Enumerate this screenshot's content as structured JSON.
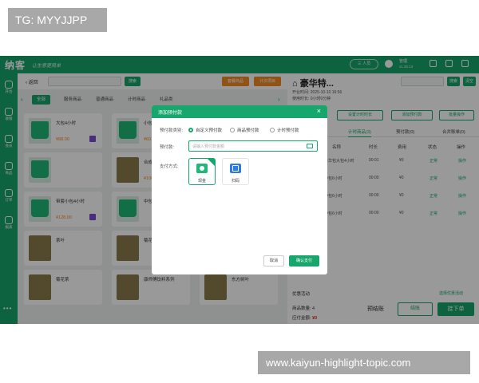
{
  "watermarks": {
    "top": "TG: MYYJJPP",
    "bottom": "www.kaiyun-highlight-topic.com"
  },
  "topbar": {
    "logo": "纳客",
    "slogan": "让生意更简单",
    "staff_button": "三 人员",
    "user_name": "管理",
    "version": "v1.30.13"
  },
  "sidebar": {
    "items": [
      "开台",
      "收银",
      "会员",
      "商品",
      "订单",
      "报表"
    ],
    "more": "更多"
  },
  "left": {
    "back": "返回",
    "search_placeholder": "输入商品名称/编码",
    "search_button": "搜索",
    "orange_buttons": [
      "套餐商品",
      "计次项目"
    ],
    "tabs": [
      "全部",
      "服务商品",
      "普通商品",
      "计时商品",
      "礼品类"
    ],
    "cards": [
      {
        "name": "大包4小时",
        "price": "¥88.00",
        "type": "bag"
      },
      {
        "name": "小包",
        "price": "¥60.00",
        "type": "bag"
      },
      {
        "name": "",
        "price": "¥48.00",
        "type": "bag"
      },
      {
        "name": "",
        "price": "",
        "type": "bag"
      },
      {
        "name": "合成装下100",
        "price": "¥100.00",
        "type": "photo"
      },
      {
        "name": "豪华",
        "price": "",
        "type": "bag"
      },
      {
        "name": "带套小包4小时",
        "price": "¥128.00",
        "type": "bag"
      },
      {
        "name": "中包",
        "price": "",
        "type": "bag"
      },
      {
        "name": "优雅大包6小时",
        "price": "¥168.00",
        "type": "bag"
      },
      {
        "name": "茶叶",
        "price": "",
        "type": "photo"
      },
      {
        "name": "菊花茶一杯",
        "price": "",
        "type": "photo"
      },
      {
        "name": "绿茶",
        "price": "",
        "type": "photo"
      },
      {
        "name": "菊花茶",
        "price": "",
        "type": "photo"
      },
      {
        "name": "康师傅饮料系列",
        "price": "",
        "type": "photo"
      },
      {
        "name": "东方树叶",
        "price": "",
        "type": "photo"
      }
    ]
  },
  "right": {
    "title": "豪华特...",
    "open_time": "开台时间: 2025-10-10 16:56",
    "used_time": "使用时长: 0小时0分钟",
    "search_buttons": [
      "搜索",
      "清空"
    ],
    "action_buttons": [
      "设置计时时长",
      "添加预付款",
      "批量操作"
    ],
    "tabs": [
      "计时商品(3)",
      "预付款(0)",
      "合并账单(0)"
    ],
    "headers": [
      "名称",
      "时长",
      "费用",
      "状态",
      "操作"
    ],
    "rows": [
      {
        "name": "豪华包大包4小时",
        "dur": "00:01",
        "fee": "¥0",
        "status": "正常",
        "op": "操作"
      },
      {
        "name": "中包6小时",
        "dur": "00:00",
        "fee": "¥0",
        "status": "正常",
        "op": "操作"
      },
      {
        "name": "中包6小时",
        "dur": "00:00",
        "fee": "¥0",
        "status": "正常",
        "op": "操作"
      },
      {
        "name": "中包6小时",
        "dur": "00:00",
        "fee": "¥0",
        "status": "正常",
        "op": "操作"
      }
    ],
    "discount_label": "优惠活动",
    "discount_link": "选择优惠活动",
    "count_label": "商品数量: 4",
    "amount_label": "应付金额:",
    "amount_value": "¥0",
    "prepay_button": "预结账",
    "settle_button": "结账",
    "order_button": "挂下单"
  },
  "modal": {
    "title": "添加预付款",
    "type_label": "预付款类别:",
    "options": [
      "自定义预付款",
      "商品预付款",
      "计时预付款"
    ],
    "amount_label": "预付款:",
    "amount_placeholder": "请输入预付款金额",
    "method_label": "支付方式:",
    "methods": [
      "现金",
      "扫码"
    ],
    "cancel": "取消",
    "confirm": "确认支付"
  },
  "colors": {
    "brand": "#17a66c",
    "accent_orange": "#f08a24",
    "amount_red": "#e2332f"
  }
}
